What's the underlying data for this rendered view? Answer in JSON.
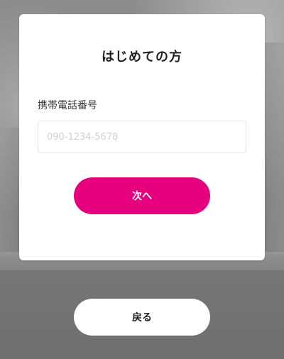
{
  "dialog": {
    "title": "はじめての方",
    "phone_label": "携帯電話番号",
    "phone_value": "",
    "phone_placeholder": "090-1234-5678",
    "next_label": "次へ"
  },
  "footer": {
    "back_label": "戻る"
  },
  "colors": {
    "accent": "#e6007e",
    "card_background": "#ffffff"
  }
}
